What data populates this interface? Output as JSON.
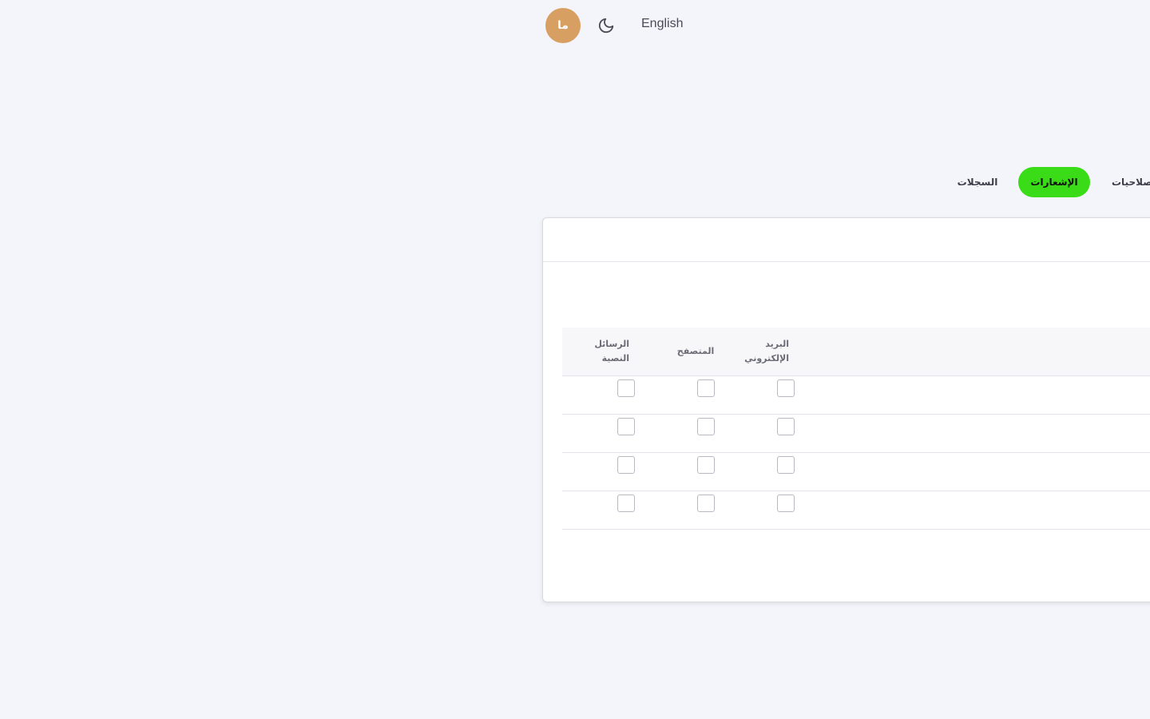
{
  "header": {
    "avatar_initials": "ما",
    "language_switch": "English",
    "theme_icon": "moon-icon",
    "avatar_color": "#d79f62"
  },
  "tabs": [
    {
      "label": "السجلات",
      "active": false
    },
    {
      "label": "الإشعارات",
      "active": true
    },
    {
      "label": "صلاحيات",
      "active": false
    }
  ],
  "accent_color": "#39dc16",
  "notifications_table": {
    "columns": {
      "email": "البريد\nالإلكتروني",
      "browser": "المتصفح",
      "sms": "الرسائل\nالنصية"
    },
    "rows": [
      {
        "email": false,
        "browser": false,
        "sms": false
      },
      {
        "email": false,
        "browser": false,
        "sms": false
      },
      {
        "email": false,
        "browser": false,
        "sms": false
      },
      {
        "email": false,
        "browser": false,
        "sms": false
      }
    ]
  }
}
